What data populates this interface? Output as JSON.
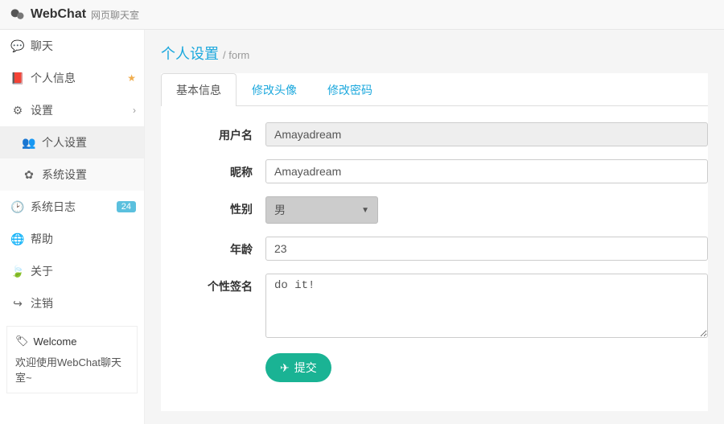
{
  "header": {
    "brand": "WebChat",
    "subtitle": "网页聊天室"
  },
  "sidebar": {
    "items": [
      {
        "label": "聊天"
      },
      {
        "label": "个人信息"
      },
      {
        "label": "设置"
      },
      {
        "label": "个人设置"
      },
      {
        "label": "系统设置"
      },
      {
        "label": "系统日志",
        "badge": "24"
      },
      {
        "label": "帮助"
      },
      {
        "label": "关于"
      },
      {
        "label": "注销"
      }
    ],
    "welcome": {
      "title": "Welcome",
      "text": "欢迎使用WebChat聊天室~"
    }
  },
  "page": {
    "title": "个人设置",
    "sub": "/ form"
  },
  "tabs": [
    {
      "label": "基本信息"
    },
    {
      "label": "修改头像"
    },
    {
      "label": "修改密码"
    }
  ],
  "form": {
    "username": {
      "label": "用户名",
      "value": "Amayadream"
    },
    "nickname": {
      "label": "昵称",
      "value": "Amayadream"
    },
    "gender": {
      "label": "性别",
      "value": "男"
    },
    "age": {
      "label": "年龄",
      "value": "23"
    },
    "signature": {
      "label": "个性签名",
      "value": "do it!"
    },
    "submit": "提交"
  }
}
